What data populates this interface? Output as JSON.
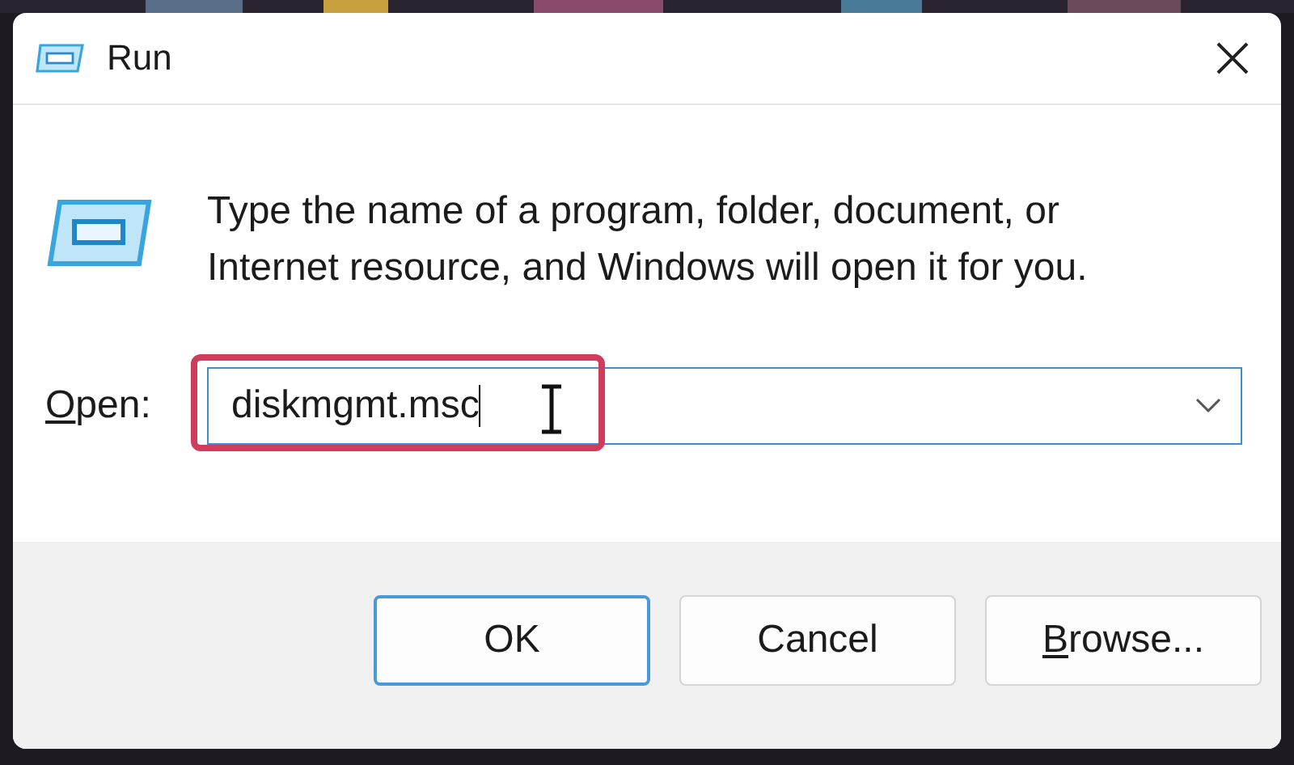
{
  "window": {
    "title": "Run"
  },
  "message": "Type the name of a program, folder, document, or Internet resource, and Windows will open it for you.",
  "open_field": {
    "label": "Open:",
    "mnemonic_underlined": true,
    "value": "diskmgmt.msc",
    "highlighted": true
  },
  "buttons": [
    {
      "label": "OK",
      "default": true,
      "mnemonic_underlined": false
    },
    {
      "label": "Cancel",
      "default": false,
      "mnemonic_underlined": false
    },
    {
      "label": "Browse...",
      "default": false,
      "mnemonic_underlined": true
    }
  ]
}
